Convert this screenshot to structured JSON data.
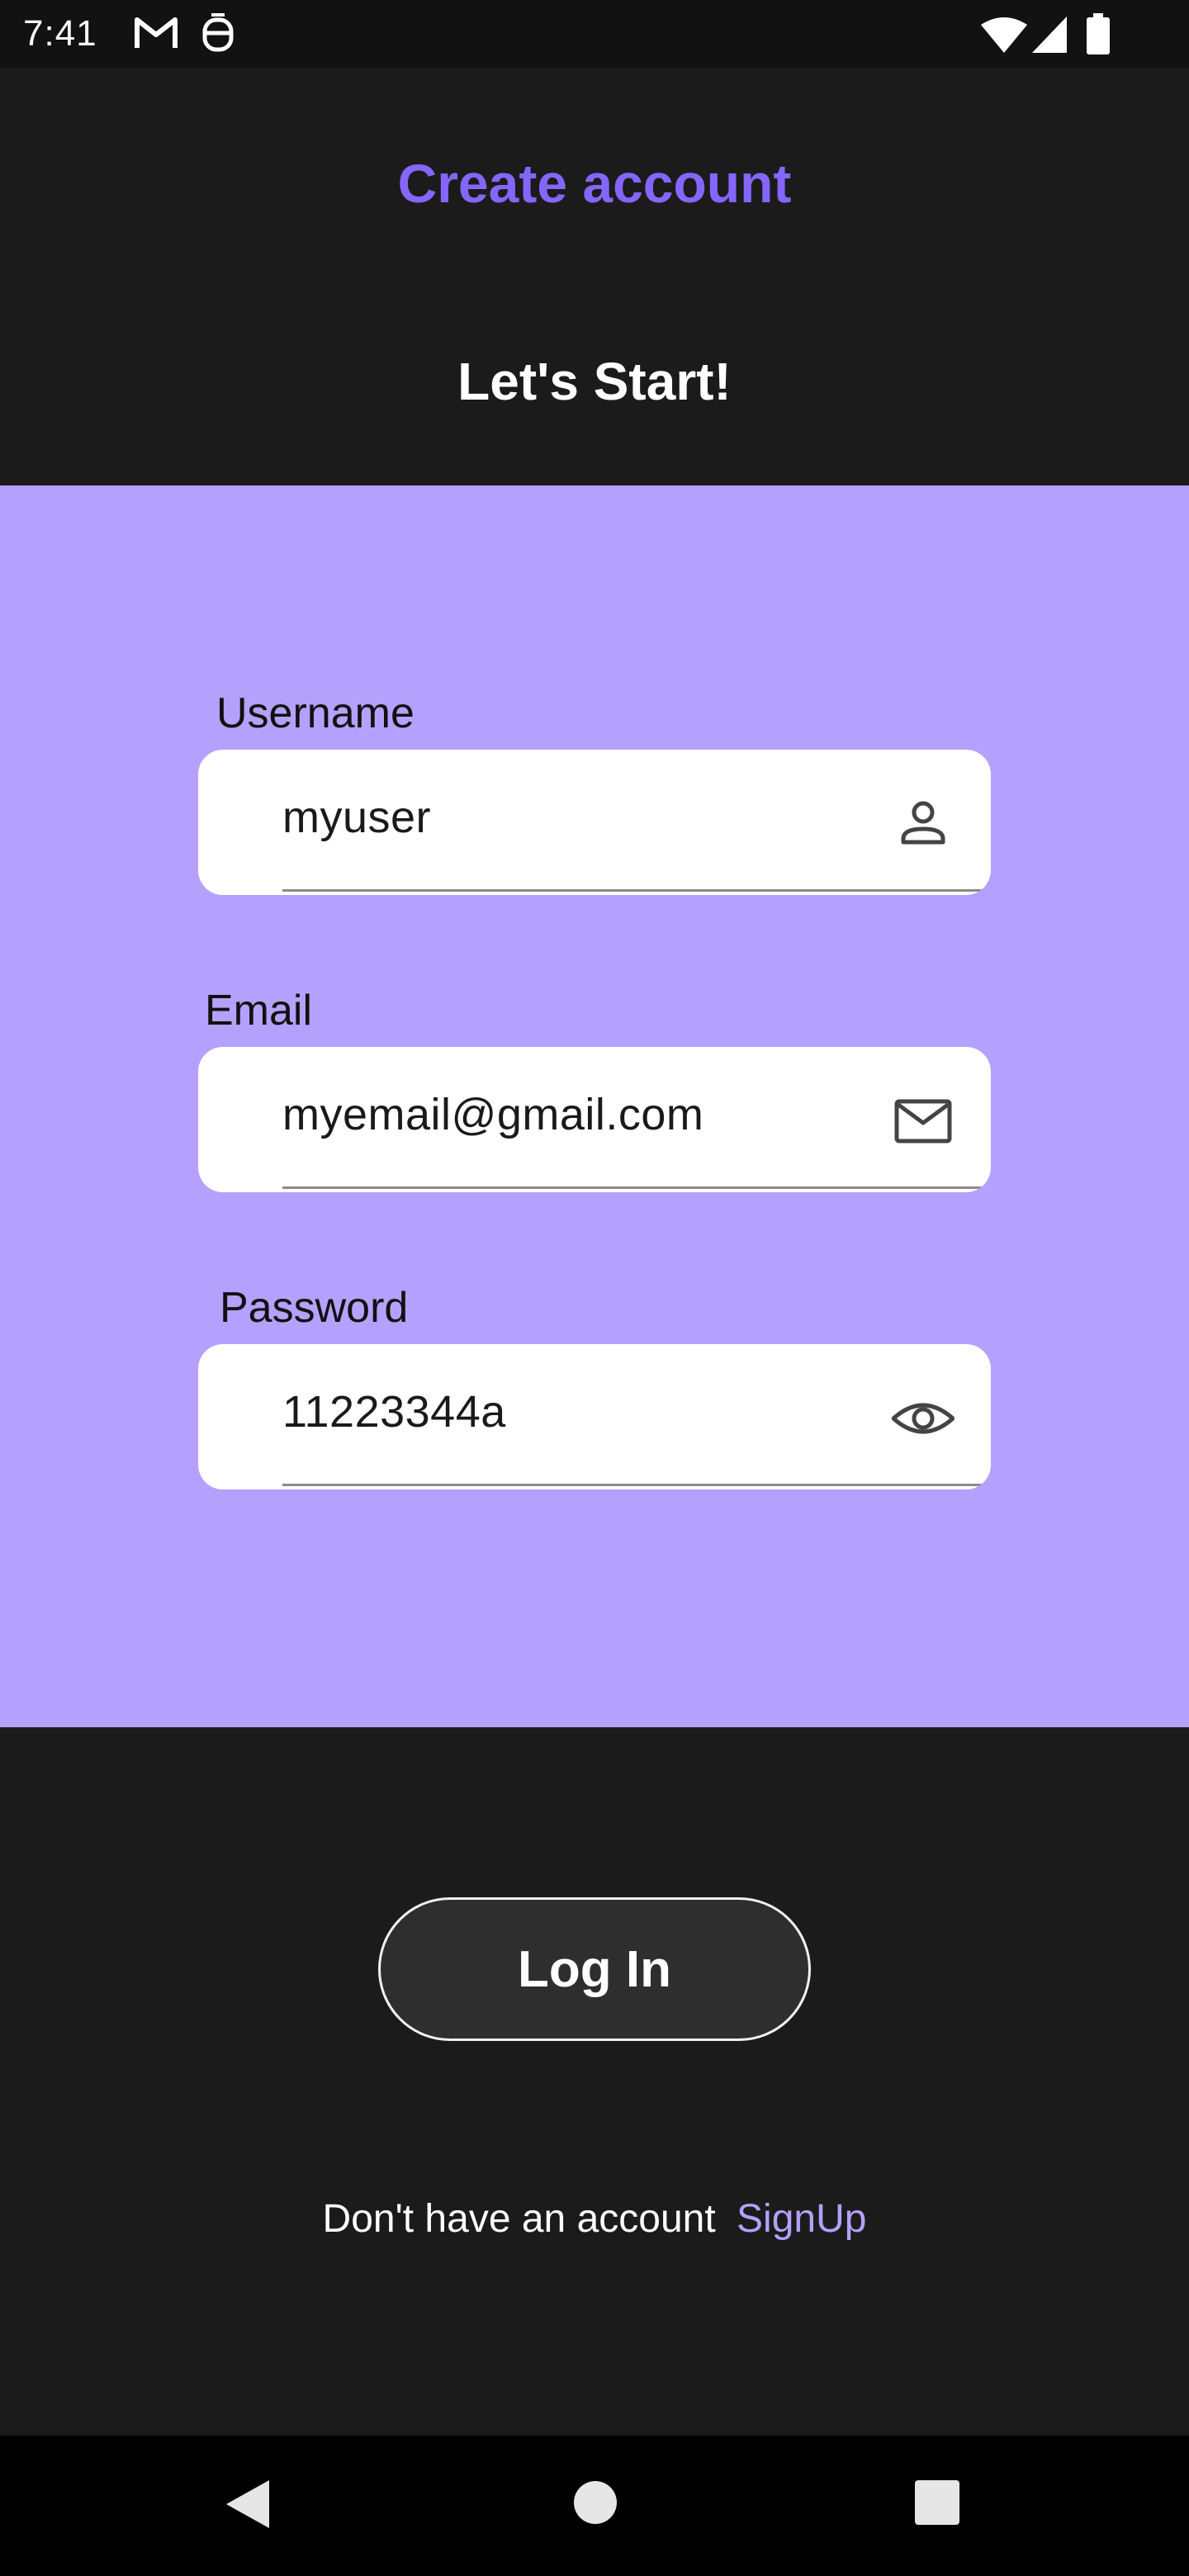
{
  "status_bar": {
    "time": "7:41",
    "icons_left": [
      "gmail-icon",
      "notification-app-icon"
    ],
    "icons_right": [
      "wifi-icon",
      "cellular-signal-icon",
      "battery-icon"
    ]
  },
  "header": {
    "title": "Create account",
    "subtitle": "Let's Start!"
  },
  "form": {
    "username": {
      "label": "Username",
      "value": "myuser",
      "icon": "person-icon"
    },
    "email": {
      "label": "Email",
      "value": "myemail@gmail.com",
      "icon": "mail-icon"
    },
    "password": {
      "label": "Password",
      "value": "11223344a",
      "icon": "eye-icon"
    }
  },
  "actions": {
    "login_label": "Log In",
    "signup_prompt": "Don't have an account",
    "signup_link": "SignUp"
  },
  "nav_bar": {
    "buttons": [
      "back-icon",
      "home-icon",
      "recents-icon"
    ]
  },
  "colors": {
    "background": "#1b1b1b",
    "panel": "#b3a1fd",
    "accent": "#8466ff",
    "link": "#b3a1fd"
  }
}
